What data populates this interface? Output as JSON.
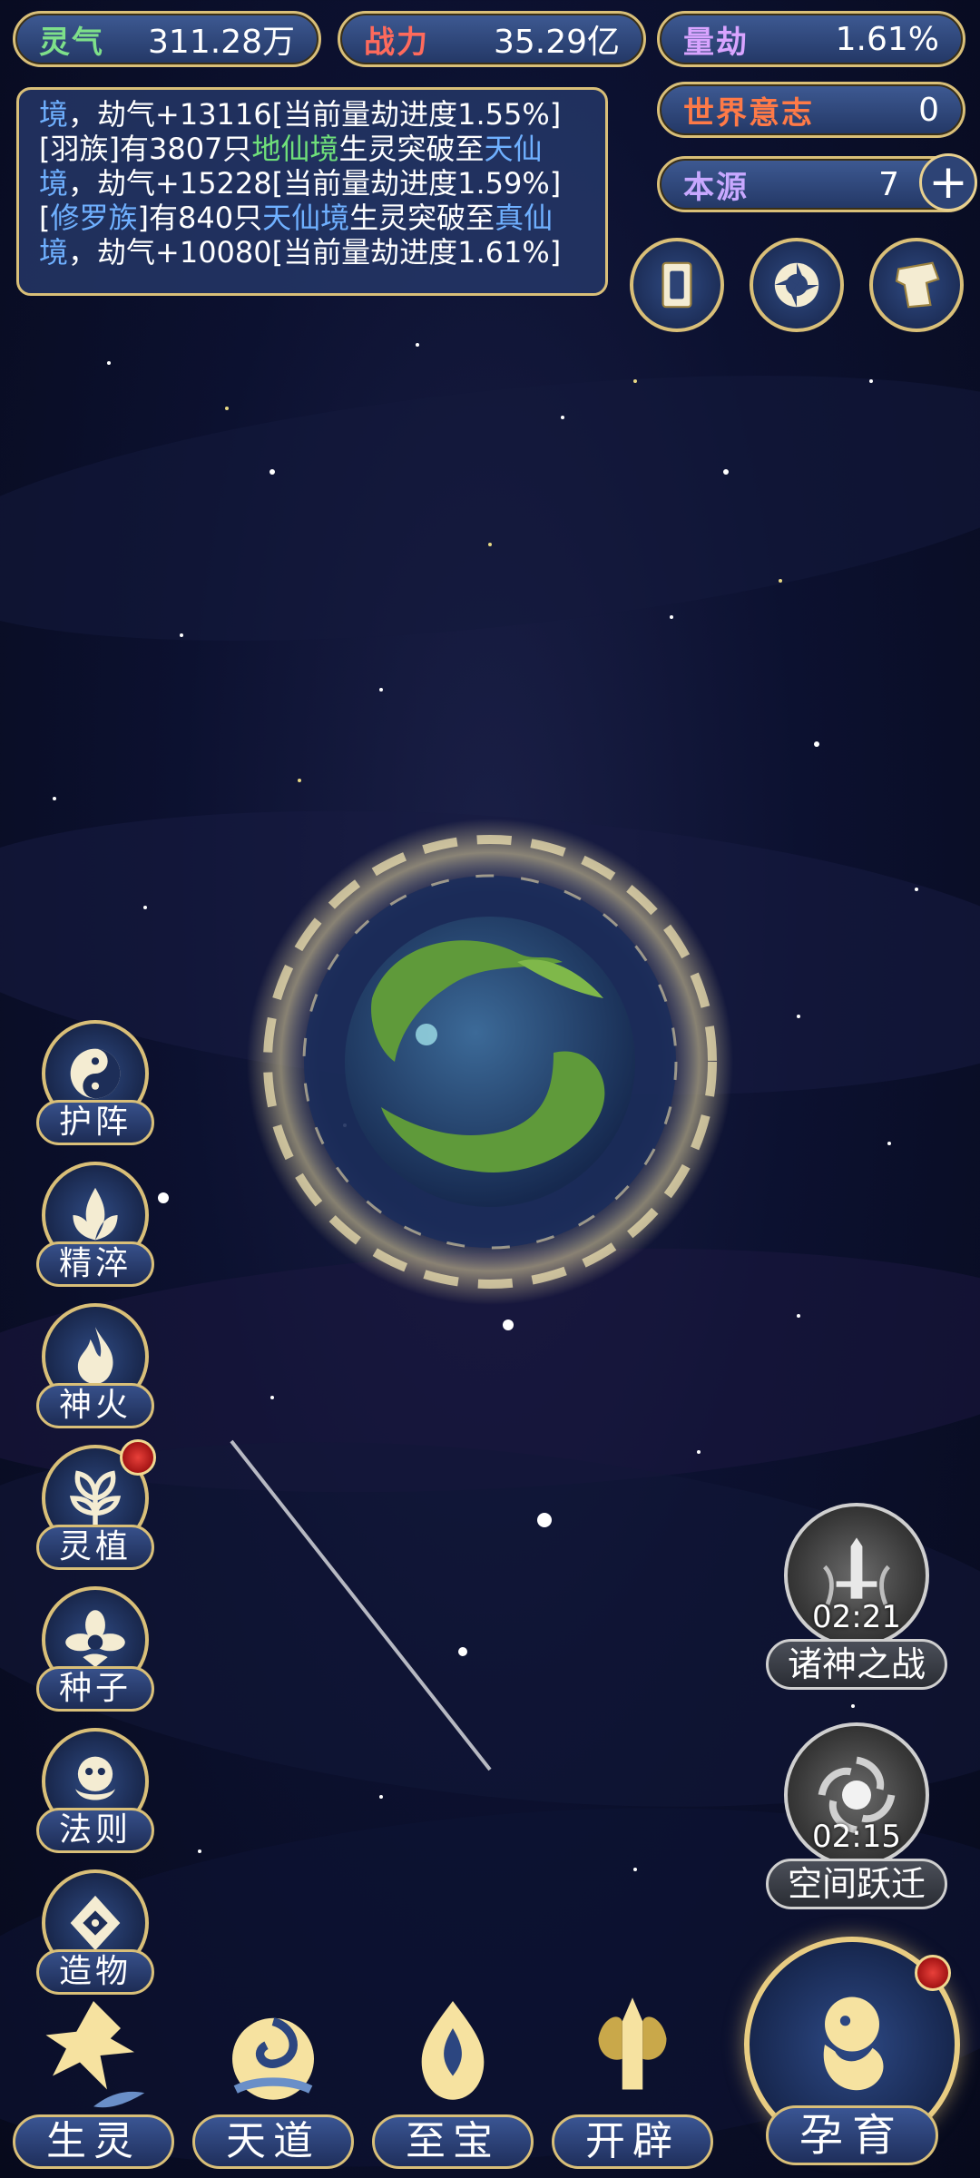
{
  "stats": {
    "lingqi": {
      "label": "灵气",
      "value": "311.28万"
    },
    "zhanli": {
      "label": "战力",
      "value": "35.29亿"
    },
    "liangjie": {
      "label": "量劫",
      "value": "1.61%"
    },
    "shijie_yizhi": {
      "label": "世界意志",
      "value": "0"
    },
    "benyuan": {
      "label": "本源",
      "value": "7",
      "plus": "+"
    }
  },
  "log": {
    "line1_a": "境",
    "line1_b": "，劫气+13116[当前量劫进度1.55%]",
    "line2_a": "[羽族]有3807只",
    "line2_b": "地仙境",
    "line2_c": "生灵突破至",
    "line2_d": "天仙",
    "line3_a": "境",
    "line3_b": "，劫气+15228[当前量劫进度1.59%]",
    "line4_a": "[",
    "line4_b": "修罗族",
    "line4_c": "]有840只",
    "line4_d": "天仙境",
    "line4_e": "生灵突破至",
    "line4_f": "真仙",
    "line5_a": "境",
    "line5_b": "，劫气+10080[当前量劫进度1.61%]"
  },
  "top_icons": [
    "card-icon",
    "vortex-icon",
    "scroll-icon"
  ],
  "side_menu": [
    {
      "label": "护阵",
      "icon": "yin-yang-icon"
    },
    {
      "label": "精淬",
      "icon": "lotus-flame-icon"
    },
    {
      "label": "神火",
      "icon": "fire-icon"
    },
    {
      "label": "灵植",
      "icon": "plant-icon",
      "badge": true
    },
    {
      "label": "种子",
      "icon": "seed-flower-icon"
    },
    {
      "label": "法则",
      "icon": "law-icon"
    },
    {
      "label": "造物",
      "icon": "creation-icon"
    }
  ],
  "events": [
    {
      "label": "诸神之战",
      "timer": "02:21",
      "icon": "sword-icon"
    },
    {
      "label": "空间跃迁",
      "timer": "02:15",
      "icon": "space-icon"
    }
  ],
  "bottom_nav": [
    {
      "label": "生灵",
      "icon": "phoenix-icon"
    },
    {
      "label": "天道",
      "icon": "cloud-swirl-icon"
    },
    {
      "label": "至宝",
      "icon": "treasure-icon"
    },
    {
      "label": "开辟",
      "icon": "axe-icon"
    }
  ],
  "main_action": {
    "label": "孕育",
    "icon": "embryo-icon",
    "badge": true
  },
  "colors": {
    "gold_border": "#d9bf78",
    "pill_blue": "#2d4375",
    "log_blue_text": "#6fb0ff",
    "log_green_text": "#6fe07a"
  }
}
